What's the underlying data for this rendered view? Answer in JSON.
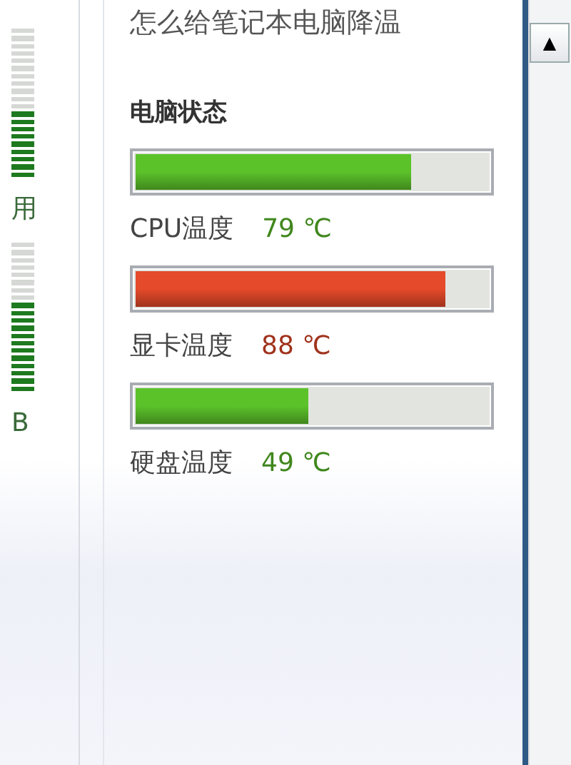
{
  "left_panel": {
    "items": [
      {
        "kind": "meter",
        "level": 0.45
      },
      {
        "kind": "label",
        "text": "用"
      },
      {
        "kind": "meter",
        "level": 0.6
      },
      {
        "kind": "label",
        "text": "B"
      }
    ]
  },
  "article_title": "怎么给笔记本电脑降温",
  "section_title": "电脑状态",
  "sensors": [
    {
      "label": "CPU温度",
      "reading": "79 ℃",
      "level": 0.78,
      "color": "#5cc22a"
    },
    {
      "label": "显卡温度",
      "reading": "88 ℃",
      "level": 0.88,
      "color": "#e54a2a"
    },
    {
      "label": "硬盘温度",
      "reading": "49 ℃",
      "level": 0.49,
      "color": "#5cc22a"
    }
  ],
  "scrollbar": {
    "up_arrow": "▲"
  }
}
